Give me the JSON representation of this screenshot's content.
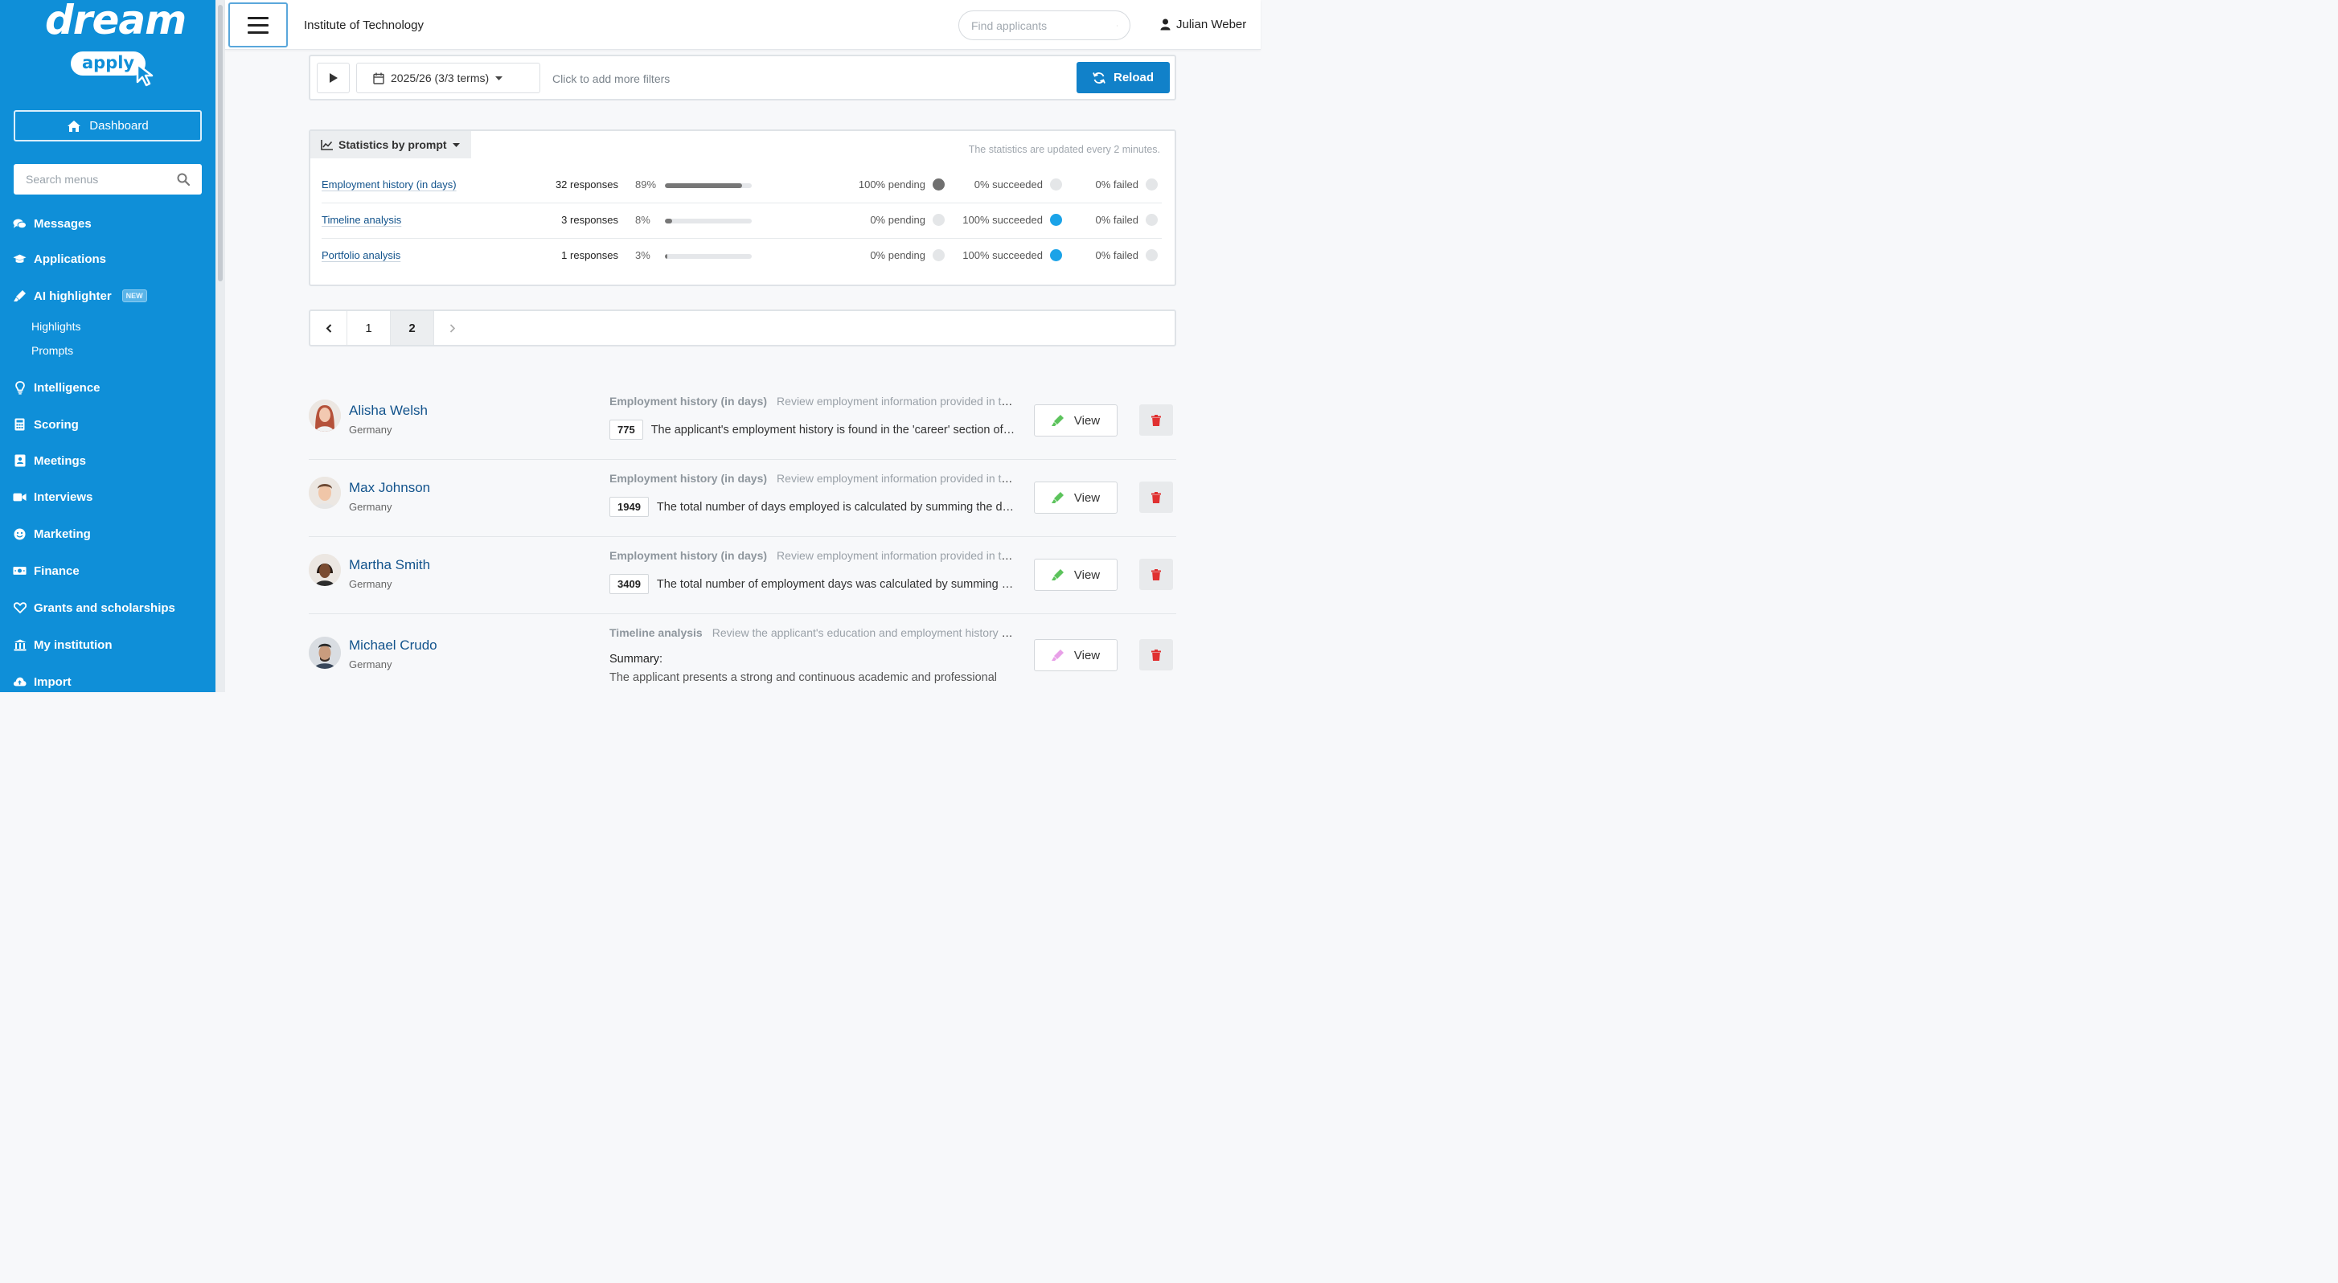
{
  "brand": {
    "logo_word": "dream",
    "logo_sub": "apply"
  },
  "sidebar": {
    "dashboard_label": "Dashboard",
    "search_placeholder": "Search menus",
    "items": [
      {
        "label": "Messages",
        "icon": "comments-icon"
      },
      {
        "label": "Applications",
        "icon": "graduation-cap-icon"
      },
      {
        "label": "AI highlighter",
        "icon": "highlighter-icon",
        "badge": "NEW"
      },
      {
        "label": "Intelligence",
        "icon": "lightbulb-icon"
      },
      {
        "label": "Scoring",
        "icon": "calculator-icon"
      },
      {
        "label": "Meetings",
        "icon": "contact-card-icon"
      },
      {
        "label": "Interviews",
        "icon": "video-camera-icon"
      },
      {
        "label": "Marketing",
        "icon": "smile-icon"
      },
      {
        "label": "Finance",
        "icon": "money-bill-icon"
      },
      {
        "label": "Grants and scholarships",
        "icon": "heart-icon"
      },
      {
        "label": "My institution",
        "icon": "university-icon"
      },
      {
        "label": "Import",
        "icon": "cloud-upload-icon"
      }
    ],
    "subitems": [
      "Highlights",
      "Prompts"
    ]
  },
  "header": {
    "institution": "Institute of Technology",
    "search_placeholder": "Find applicants",
    "user_name": "Julian Weber"
  },
  "filters": {
    "term": "2025/26 (3/3 terms)",
    "more_filters": "Click to add more filters",
    "reload_label": "Reload"
  },
  "stats": {
    "tab_label": "Statistics by prompt",
    "note": "The statistics are updated every 2 minutes.",
    "rows": [
      {
        "name": "Employment history (in days)",
        "responses": "32 responses",
        "pct": "89%",
        "fill": 0.89,
        "pending": "100% pending",
        "succeeded": "0% succeeded",
        "failed": "0% failed",
        "active": "pending"
      },
      {
        "name": "Timeline analysis",
        "responses": "3 responses",
        "pct": "8%",
        "fill": 0.08,
        "pending": "0% pending",
        "succeeded": "100% succeeded",
        "failed": "0% failed",
        "active": "succeeded"
      },
      {
        "name": "Portfolio analysis",
        "responses": "1 responses",
        "pct": "3%",
        "fill": 0.03,
        "pending": "0% pending",
        "succeeded": "100% succeeded",
        "failed": "0% failed",
        "active": "succeeded"
      }
    ]
  },
  "pagination": {
    "pages": [
      "1",
      "2"
    ],
    "current": "2"
  },
  "applicants": [
    {
      "name": "Alisha Welsh",
      "country": "Germany",
      "prompt": "Employment history (in days)",
      "prompt_desc": "Review employment information provided in the application",
      "value": "775",
      "result": "The applicant's employment history is found in the 'career' section of the application",
      "view_label": "View"
    },
    {
      "name": "Max Johnson",
      "country": "Germany",
      "prompt": "Employment history (in days)",
      "prompt_desc": "Review employment information provided in the application",
      "value": "1949",
      "result": "The total number of days employed is calculated by summing the durations of each position",
      "view_label": "View"
    },
    {
      "name": "Martha Smith",
      "country": "Germany",
      "prompt": "Employment history (in days)",
      "prompt_desc": "Review employment information provided in the application",
      "value": "3409",
      "result": "The total number of employment days was calculated by summing all employment periods",
      "view_label": "View"
    },
    {
      "name": "Michael Crudo",
      "country": "Germany",
      "prompt": "Timeline analysis",
      "prompt_desc": "Review the applicant's education and employment history for gaps",
      "summary_label": "Summary:",
      "summary": "The applicant presents a strong and continuous academic and professional",
      "view_label": "View"
    }
  ]
}
